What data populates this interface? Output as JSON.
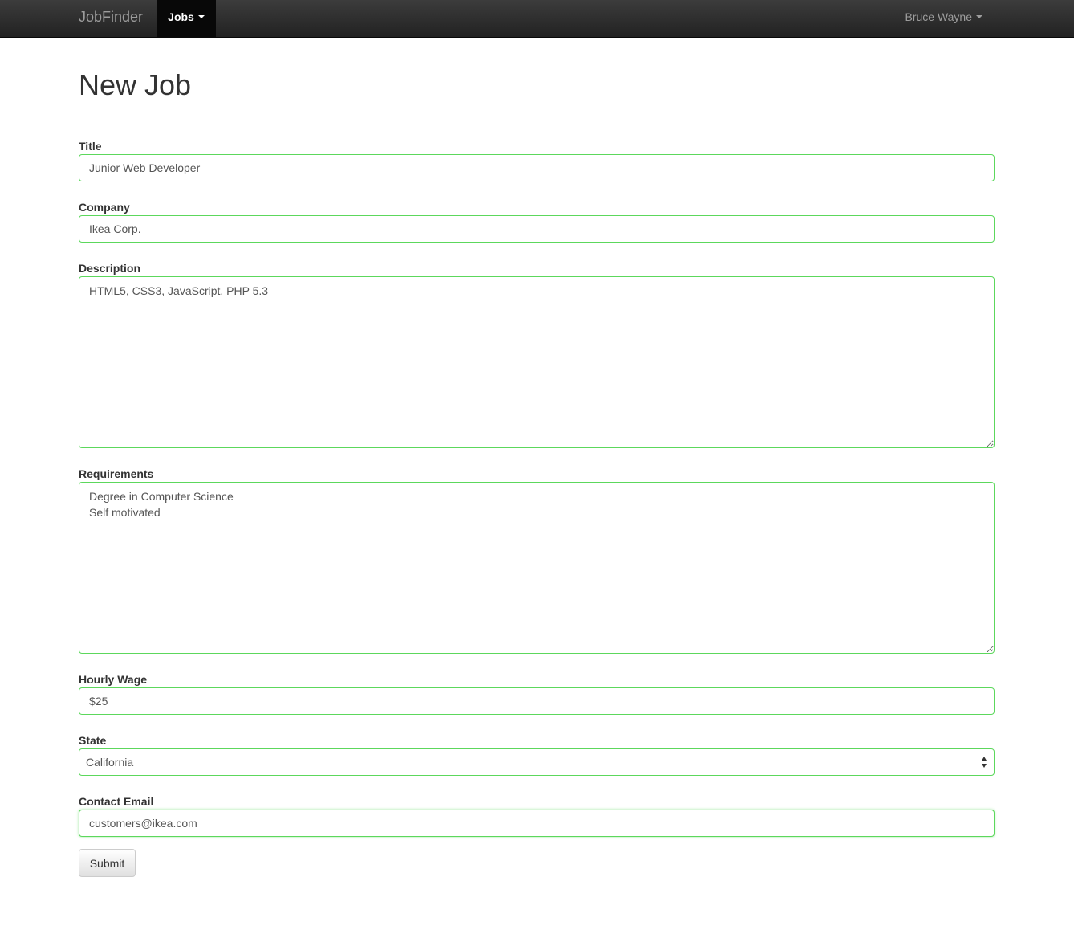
{
  "navbar": {
    "brand": "JobFinder",
    "jobs_menu": "Jobs",
    "user_menu": "Bruce Wayne"
  },
  "page": {
    "title": "New Job"
  },
  "form": {
    "title": {
      "label": "Title",
      "value": "Junior Web Developer"
    },
    "company": {
      "label": "Company",
      "value": "Ikea Corp."
    },
    "description": {
      "label": "Description",
      "value": "HTML5, CSS3, JavaScript, PHP 5.3"
    },
    "requirements": {
      "label": "Requirements",
      "value": "Degree in Computer Science\nSelf motivated"
    },
    "hourly_wage": {
      "label": "Hourly Wage",
      "value": "$25"
    },
    "state": {
      "label": "State",
      "value": "California"
    },
    "contact_email": {
      "label": "Contact Email",
      "value": "customers@ikea.com"
    },
    "submit_label": "Submit"
  },
  "colors": {
    "navbar": "#222222",
    "field_border": "#5cd85c",
    "text": "#333333"
  }
}
